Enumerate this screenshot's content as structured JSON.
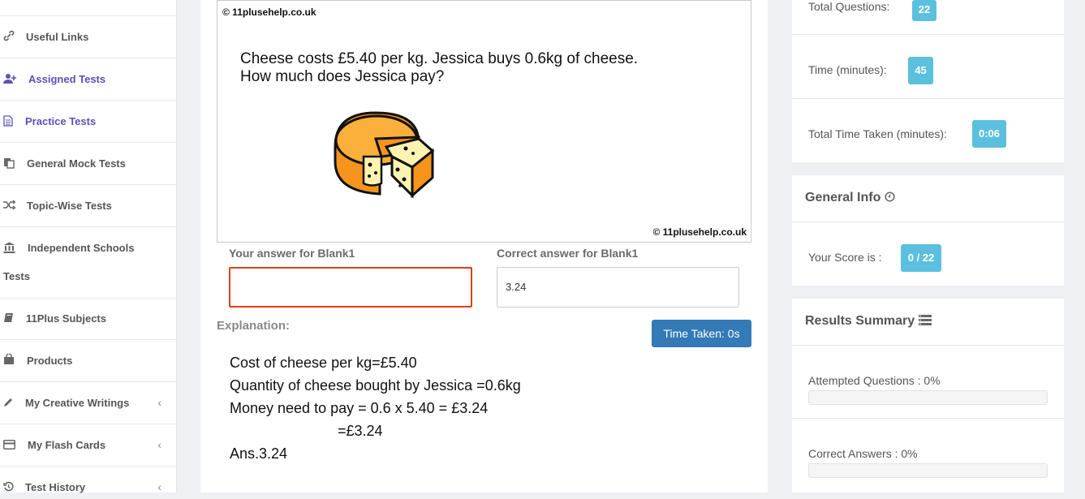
{
  "sidebar": {
    "items": [
      {
        "label": "Useful Links",
        "icon": "link-icon"
      },
      {
        "label": "Assigned Tests",
        "icon": "user-plus-icon"
      },
      {
        "label": "Practice Tests",
        "icon": "document-icon"
      },
      {
        "label": "General Mock Tests",
        "icon": "copy-icon"
      },
      {
        "label": "Topic-Wise Tests",
        "icon": "shuffle-icon"
      },
      {
        "label": "Independent Schools",
        "label2": "Tests",
        "icon": "bank-icon"
      },
      {
        "label": "11Plus Subjects",
        "icon": "book-icon"
      },
      {
        "label": "Products",
        "icon": "bag-icon"
      },
      {
        "label": "My Creative Writings",
        "icon": "pencil-icon"
      },
      {
        "label": "My Flash Cards",
        "icon": "credit-card-icon"
      },
      {
        "label": "Test History",
        "icon": "history-icon"
      }
    ]
  },
  "question": {
    "watermark": "© 11plusehelp.co.uk",
    "line1": "Cheese costs £5.40 per kg. Jessica buys 0.6kg of cheese.",
    "line2": "How much does Jessica pay?"
  },
  "answers": {
    "your_label": "Your answer for Blank1",
    "your_value": "",
    "correct_label": "Correct answer for Blank1",
    "correct_value": "3.24"
  },
  "explanation": {
    "label": "Explanation:",
    "time_taken": "Time Taken: 0s",
    "lines": [
      "Cost of cheese per kg=£5.40",
      "Quantity of cheese bought by Jessica =0.6kg",
      "Money need to pay = 0.6 x 5.40 = £3.24",
      "=£3.24",
      "Ans.3.24"
    ]
  },
  "stats": {
    "total_questions_label": "Total Questions:",
    "total_questions": "22",
    "time_label": "Time (minutes):",
    "time": "45",
    "time_taken_label": "Total Time Taken (minutes):",
    "time_taken": "0:06"
  },
  "general_info": {
    "title": "General Info",
    "score_label": "Your Score is :",
    "score": "0 / 22"
  },
  "results": {
    "title": "Results Summary",
    "attempted_label": "Attempted Questions : 0%",
    "attempted_pct": 0,
    "correct_label": "Correct Answers : 0%",
    "correct_pct": 0
  },
  "colors": {
    "accent": "#5a52b8",
    "badge": "#5bc0de",
    "button": "#337ab7",
    "error_border": "#d84315"
  }
}
